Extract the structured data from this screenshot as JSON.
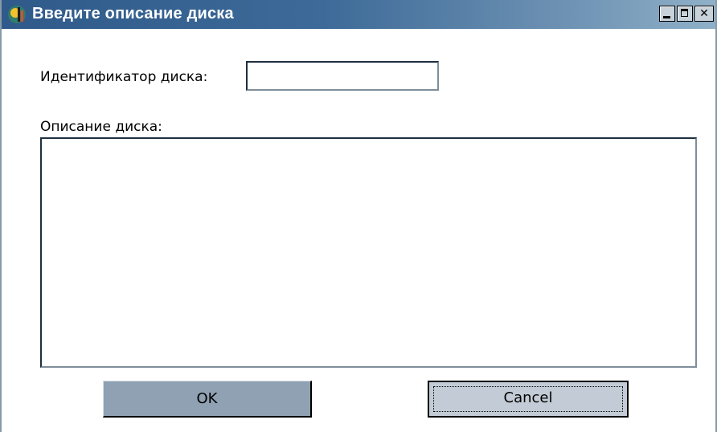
{
  "window": {
    "title": "Введите описание диска",
    "icon": "app-icon",
    "controls": {
      "minimize_icon": "minimize-icon",
      "maximize_icon": "maximize-icon",
      "close_glyph": "✕"
    }
  },
  "form": {
    "disk_id_label": "Идентификатор диска:",
    "disk_id_value": "",
    "description_label": "Описание диска:",
    "description_value": ""
  },
  "buttons": {
    "ok_label": "OK",
    "cancel_label": "Cancel"
  },
  "colors": {
    "titlebar_start": "#2f5a8a",
    "titlebar_end": "#8fb0c8",
    "ok_button": "#8fa1b3",
    "cancel_button": "#c3ccd6"
  }
}
